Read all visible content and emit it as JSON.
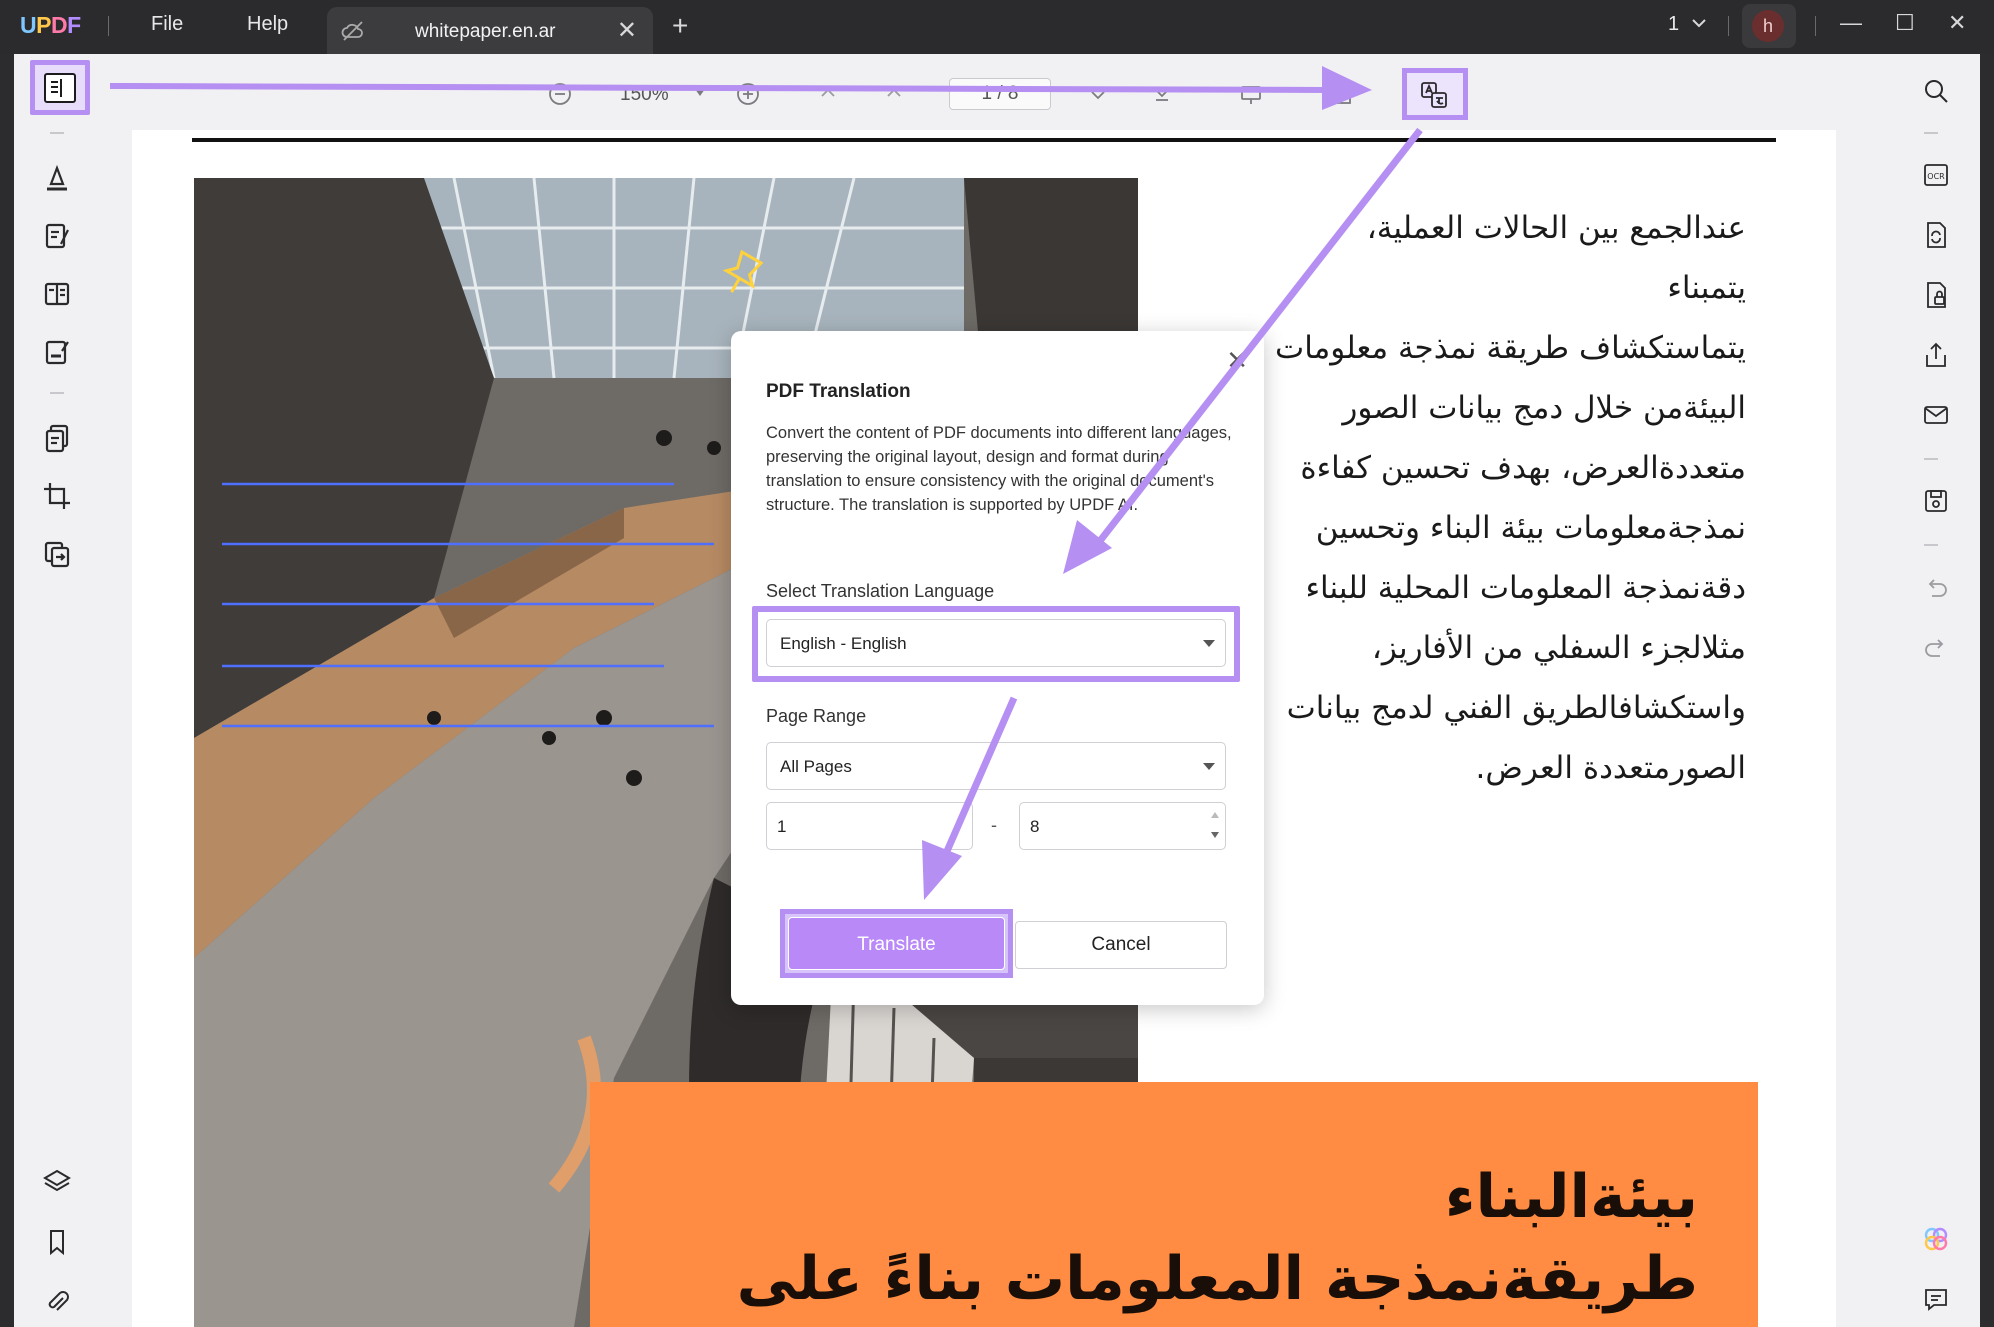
{
  "app": {
    "logo": "UPDF"
  },
  "menu": {
    "file": "File",
    "help": "Help"
  },
  "tab": {
    "title": "whitepaper.en.ar",
    "close": "✕",
    "add": "+"
  },
  "window": {
    "count": "1",
    "avatar_initial": "h",
    "minimize": "—",
    "maximize": "☐",
    "close": "✕"
  },
  "toolbar": {
    "zoom": "150%",
    "page": "1 / 8"
  },
  "document": {
    "arabic_lines": [
      "عندالجمع بين الحالات العملية،",
      "يتمبناء",
      "يتماستكشاف طريقة نمذجة معلومات",
      "البيئةمن خلال دمج بيانات الصور",
      "متعددةالعرض، بهدف تحسين كفاءة",
      "نمذجةمعلومات بيئة البناء وتحسين",
      "دقةنمذجة المعلومات المحلية للبناء",
      "مثلالجزء السفلي من الأفاريز،",
      "واستكشافالطريق الفني لدمج بيانات",
      "الصورمتعددة العرض."
    ],
    "banner_line1": "بيئةالبناء",
    "banner_line2": "طريقةنمذجة المعلومات بناءً على"
  },
  "dialog": {
    "title": "PDF Translation",
    "description": "Convert the content of PDF documents into different languages, preserving the original layout, design and format during translation to ensure consistency with the original document's structure. The translation is supported by UPDF AI.",
    "close": "✕",
    "language_label": "Select Translation Language",
    "language_value": "English - English",
    "range_label": "Page Range",
    "range_value": "All Pages",
    "range_from": "1",
    "range_dash": "-",
    "range_to": "8",
    "translate_label": "Translate",
    "cancel_label": "Cancel"
  },
  "colors": {
    "highlight": "#b58ff2",
    "primary_button": "#b98af7",
    "banner": "#ff8c42"
  }
}
